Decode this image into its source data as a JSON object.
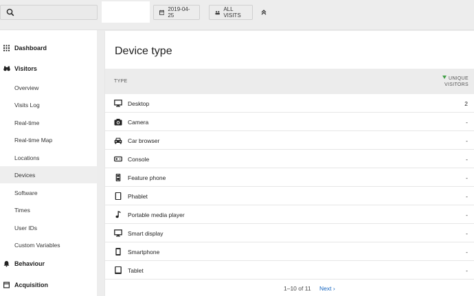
{
  "topbar": {
    "date_label": "2019-04-25",
    "segment_label": "ALL VISITS"
  },
  "sidebar": {
    "categories": [
      {
        "label": "Dashboard",
        "icon": "grid-icon"
      },
      {
        "label": "Visitors",
        "icon": "binoculars-icon"
      },
      {
        "label": "Behaviour",
        "icon": "bell-icon"
      },
      {
        "label": "Acquisition",
        "icon": "window-icon"
      }
    ],
    "visitor_items": [
      "Overview",
      "Visits Log",
      "Real-time",
      "Real-time Map",
      "Locations",
      "Devices",
      "Software",
      "Times",
      "User IDs",
      "Custom Variables"
    ],
    "active_item": "Devices"
  },
  "report": {
    "title": "Device type",
    "col_type": "TYPE",
    "col_visitors_line1": "UNIQUE",
    "col_visitors_line2": "VISITORS",
    "rows": [
      {
        "label": "Desktop",
        "value": "2",
        "icon": "desktop-icon"
      },
      {
        "label": "Camera",
        "value": "-",
        "icon": "camera-icon"
      },
      {
        "label": "Car browser",
        "value": "-",
        "icon": "car-icon"
      },
      {
        "label": "Console",
        "value": "-",
        "icon": "console-icon"
      },
      {
        "label": "Feature phone",
        "value": "-",
        "icon": "feature-phone-icon"
      },
      {
        "label": "Phablet",
        "value": "-",
        "icon": "phablet-icon"
      },
      {
        "label": "Portable media player",
        "value": "-",
        "icon": "music-note-icon"
      },
      {
        "label": "Smart display",
        "value": "-",
        "icon": "smart-display-icon"
      },
      {
        "label": "Smartphone",
        "value": "-",
        "icon": "smartphone-icon"
      },
      {
        "label": "Tablet",
        "value": "-",
        "icon": "tablet-icon"
      }
    ],
    "pagination": "1–10 of 11",
    "next_label": "Next ›"
  }
}
